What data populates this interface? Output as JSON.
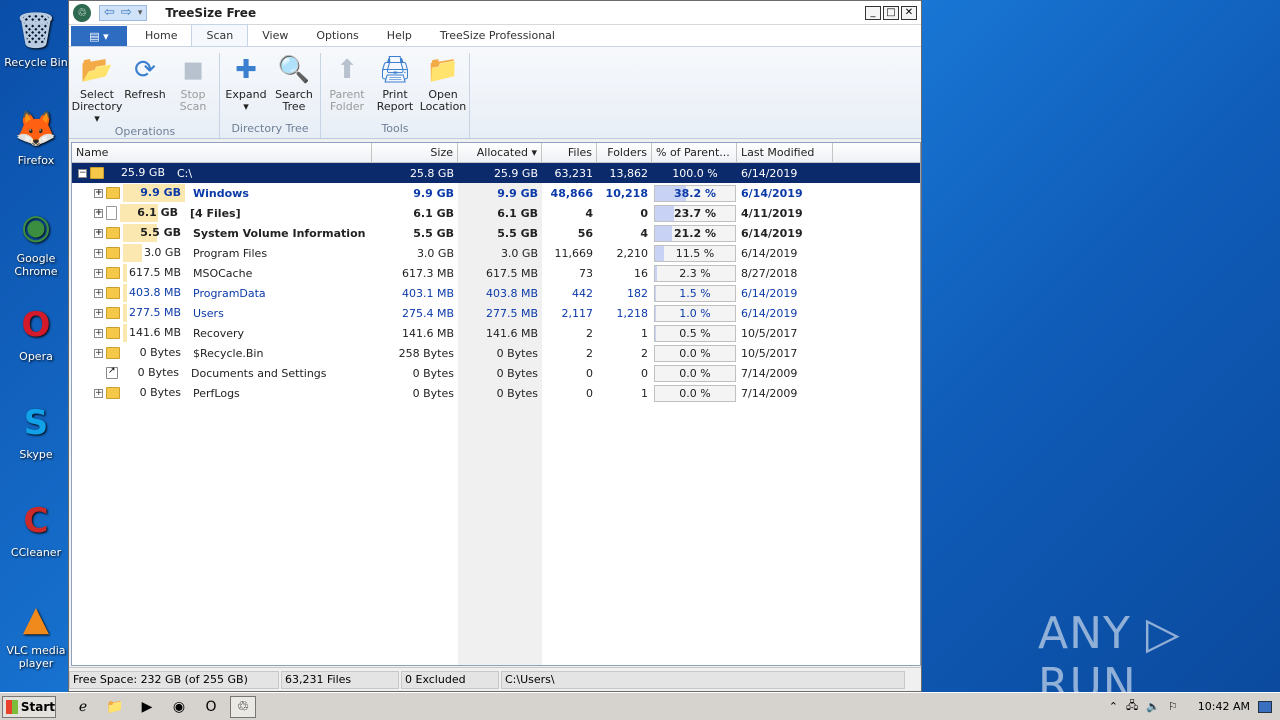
{
  "desktop": {
    "icons": [
      {
        "label": "Recycle Bin",
        "icon": "recycle-bin-icon",
        "glyph": "🗑",
        "color": "#b9cbe0"
      },
      {
        "label": "Firefox",
        "icon": "firefox-icon",
        "glyph": "🦊",
        "color": "#e8641c"
      },
      {
        "label": "Google Chrome",
        "icon": "chrome-icon",
        "glyph": "◉",
        "color": "#3b8d3f"
      },
      {
        "label": "Opera",
        "icon": "opera-icon",
        "glyph": "O",
        "color": "#d21a2a"
      },
      {
        "label": "Skype",
        "icon": "skype-icon",
        "glyph": "S",
        "color": "#10a1e8"
      },
      {
        "label": "CCleaner",
        "icon": "ccleaner-icon",
        "glyph": "C",
        "color": "#cc2a2a"
      },
      {
        "label": "VLC media player",
        "icon": "vlc-icon",
        "glyph": "▲",
        "color": "#f08a1c"
      }
    ],
    "watermark": "ANY ▷ RUN"
  },
  "window": {
    "title": "TreeSize Free",
    "menu_tabs": [
      "Home",
      "Scan",
      "View",
      "Options",
      "Help",
      "TreeSize Professional"
    ],
    "active_tab": "Scan",
    "ribbon": {
      "groups": [
        {
          "name": "Operations",
          "buttons": [
            {
              "label": "Select Directory ▾",
              "icon": "select-directory-icon",
              "glyph": "📂",
              "disabled": false
            },
            {
              "label": "Refresh",
              "icon": "refresh-icon",
              "glyph": "⟳",
              "disabled": false
            },
            {
              "label": "Stop Scan",
              "icon": "stop-scan-icon",
              "glyph": "◼",
              "disabled": true
            }
          ]
        },
        {
          "name": "Directory Tree",
          "buttons": [
            {
              "label": "Expand ▾",
              "icon": "expand-icon",
              "glyph": "✚",
              "disabled": false
            },
            {
              "label": "Search Tree",
              "icon": "search-tree-icon",
              "glyph": "🔍",
              "disabled": false
            }
          ]
        },
        {
          "name": "Tools",
          "buttons": [
            {
              "label": "Parent Folder",
              "icon": "parent-folder-icon",
              "glyph": "⬆",
              "disabled": true
            },
            {
              "label": "Print Report",
              "icon": "print-report-icon",
              "glyph": "🖨",
              "disabled": false
            },
            {
              "label": "Open Location",
              "icon": "open-location-icon",
              "glyph": "📁",
              "disabled": false
            }
          ]
        }
      ]
    },
    "columns": [
      "Name",
      "Size",
      "Allocated ▾",
      "Files",
      "Folders",
      "% of Parent...",
      "Last Modified"
    ],
    "rows": [
      {
        "size_tag": "25.9 GB",
        "name": "C:\\",
        "size": "25.8 GB",
        "allocated": "25.9 GB",
        "files": "63,231",
        "folders": "13,862",
        "pct": "100.0 %",
        "pct_value": 100,
        "modified": "6/14/2019",
        "style": "selected",
        "kind": "folder",
        "level": 0,
        "expander": "−"
      },
      {
        "size_tag": "9.9 GB",
        "name": "Windows",
        "size": "9.9 GB",
        "allocated": "9.9 GB",
        "files": "48,866",
        "folders": "10,218",
        "pct": "38.2 %",
        "pct_value": 38.2,
        "modified": "6/14/2019",
        "style": "bold blue",
        "kind": "folder",
        "level": 1,
        "expander": "+"
      },
      {
        "size_tag": "6.1 GB",
        "name": "[4 Files]",
        "size": "6.1 GB",
        "allocated": "6.1 GB",
        "files": "4",
        "folders": "0",
        "pct": "23.7 %",
        "pct_value": 23.7,
        "modified": "4/11/2019",
        "style": "bold",
        "kind": "file",
        "level": 1,
        "expander": "+"
      },
      {
        "size_tag": "5.5 GB",
        "name": "System Volume Information",
        "size": "5.5 GB",
        "allocated": "5.5 GB",
        "files": "56",
        "folders": "4",
        "pct": "21.2 %",
        "pct_value": 21.2,
        "modified": "6/14/2019",
        "style": "bold",
        "kind": "folder",
        "level": 1,
        "expander": "+"
      },
      {
        "size_tag": "3.0 GB",
        "name": "Program Files",
        "size": "3.0 GB",
        "allocated": "3.0 GB",
        "files": "11,669",
        "folders": "2,210",
        "pct": "11.5 %",
        "pct_value": 11.5,
        "modified": "6/14/2019",
        "style": "",
        "kind": "folder",
        "level": 1,
        "expander": "+"
      },
      {
        "size_tag": "617.5 MB",
        "name": "MSOCache",
        "size": "617.3 MB",
        "allocated": "617.5 MB",
        "files": "73",
        "folders": "16",
        "pct": "2.3 %",
        "pct_value": 2.3,
        "modified": "8/27/2018",
        "style": "",
        "kind": "folder",
        "level": 1,
        "expander": "+"
      },
      {
        "size_tag": "403.8 MB",
        "name": "ProgramData",
        "size": "403.1 MB",
        "allocated": "403.8 MB",
        "files": "442",
        "folders": "182",
        "pct": "1.5 %",
        "pct_value": 1.5,
        "modified": "6/14/2019",
        "style": "blue",
        "kind": "folder",
        "level": 1,
        "expander": "+"
      },
      {
        "size_tag": "277.5 MB",
        "name": "Users",
        "size": "275.4 MB",
        "allocated": "277.5 MB",
        "files": "2,117",
        "folders": "1,218",
        "pct": "1.0 %",
        "pct_value": 1.0,
        "modified": "6/14/2019",
        "style": "blue",
        "kind": "folder",
        "level": 1,
        "expander": "+"
      },
      {
        "size_tag": "141.6 MB",
        "name": "Recovery",
        "size": "141.6 MB",
        "allocated": "141.6 MB",
        "files": "2",
        "folders": "1",
        "pct": "0.5 %",
        "pct_value": 0.5,
        "modified": "10/5/2017",
        "style": "",
        "kind": "folder",
        "level": 1,
        "expander": "+"
      },
      {
        "size_tag": "0 Bytes",
        "name": "$Recycle.Bin",
        "size": "258 Bytes",
        "allocated": "0 Bytes",
        "files": "2",
        "folders": "2",
        "pct": "0.0 %",
        "pct_value": 0,
        "modified": "10/5/2017",
        "style": "",
        "kind": "folder",
        "level": 1,
        "expander": "+"
      },
      {
        "size_tag": "0 Bytes",
        "name": "Documents and Settings",
        "size": "0 Bytes",
        "allocated": "0 Bytes",
        "files": "0",
        "folders": "0",
        "pct": "0.0 %",
        "pct_value": 0,
        "modified": "7/14/2009",
        "style": "",
        "kind": "link",
        "level": 1,
        "expander": ""
      },
      {
        "size_tag": "0 Bytes",
        "name": "PerfLogs",
        "size": "0 Bytes",
        "allocated": "0 Bytes",
        "files": "0",
        "folders": "1",
        "pct": "0.0 %",
        "pct_value": 0,
        "modified": "7/14/2009",
        "style": "",
        "kind": "folder",
        "level": 1,
        "expander": "+"
      }
    ],
    "status": {
      "free_space": "Free Space: 232 GB  (of 255 GB)",
      "files": "63,231  Files",
      "excluded": "0 Excluded",
      "path": "C:\\Users\\"
    }
  },
  "taskbar": {
    "start_label": "Start",
    "clock": "10:42 AM",
    "items": [
      {
        "icon": "ie-icon",
        "glyph": "ℯ",
        "active": false
      },
      {
        "icon": "explorer-icon",
        "glyph": "📁",
        "active": false
      },
      {
        "icon": "media-player-icon",
        "glyph": "▶",
        "active": false
      },
      {
        "icon": "chrome-icon",
        "glyph": "◉",
        "active": false
      },
      {
        "icon": "opera-icon",
        "glyph": "O",
        "active": false
      },
      {
        "icon": "treesize-icon",
        "glyph": "♲",
        "active": true
      }
    ]
  }
}
